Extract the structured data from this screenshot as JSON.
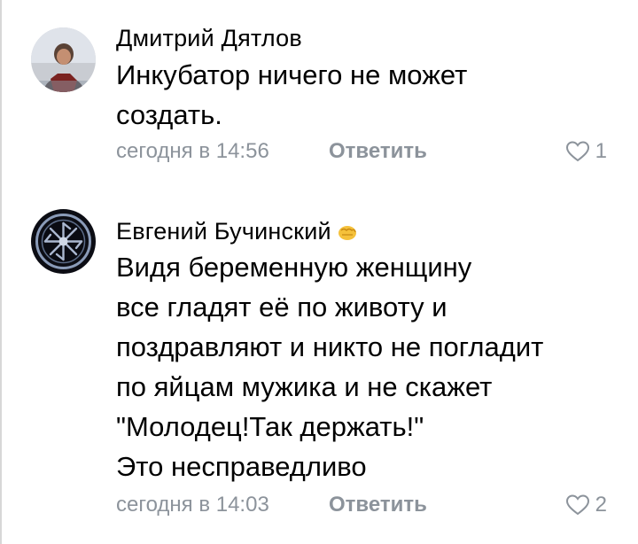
{
  "comments": [
    {
      "author": "Дмитрий Дятлов",
      "avatar_icon": "user-photo-avatar",
      "text_lines": [
        "Инкубатор ничего не может",
        "создать."
      ],
      "timestamp": "сегодня в 14:56",
      "reply_label": "Ответить",
      "likes": "1"
    },
    {
      "author": "Евгений Бучинский",
      "author_emoji": "fist-emoji",
      "avatar_icon": "circular-ornament-avatar",
      "text_lines": [
        "Видя беременную женщину",
        "все гладят её по животу и",
        "поздравляют и никто не погладит",
        "по яйцам мужика и не скажет",
        "\"Молодец!Так держать!\"",
        "Это несправедливо"
      ],
      "timestamp": "сегодня в 14:03",
      "reply_label": "Ответить",
      "likes": "2"
    }
  ],
  "colors": {
    "meta_text": "#8c939b",
    "primary_text": "#000000"
  }
}
